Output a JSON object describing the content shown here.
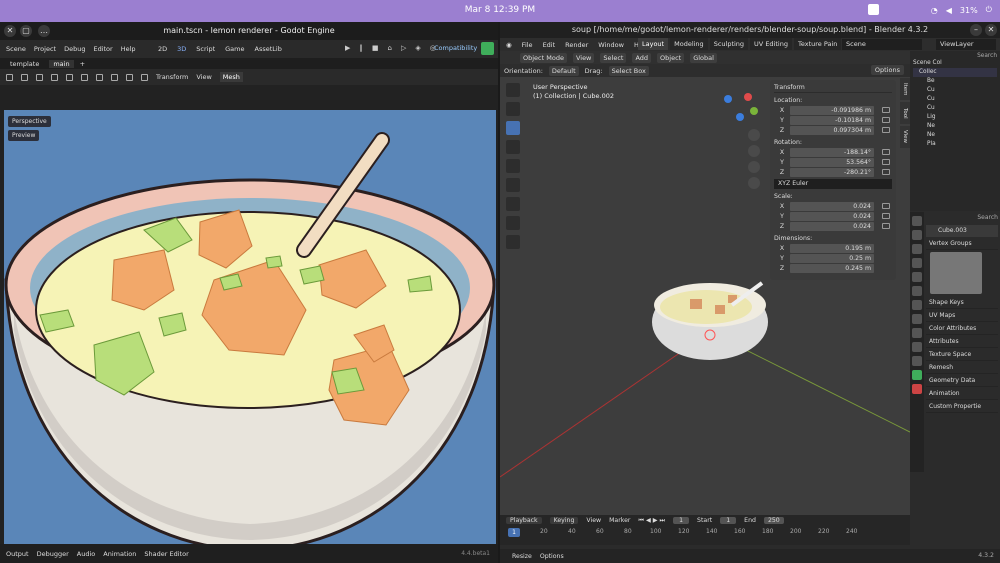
{
  "topbar": {
    "clock": "Mar 8  12:39 PM",
    "battery": "31%"
  },
  "godot": {
    "title": "main.tscn - lemon renderer - Godot Engine",
    "menu": [
      "Scene",
      "Project",
      "Debug",
      "Editor",
      "Help"
    ],
    "workspaces": [
      "2D",
      "3D",
      "Script",
      "Game",
      "AssetLib"
    ],
    "renderer": "Compatibility",
    "tabs": [
      "template",
      "main"
    ],
    "toolbar": {
      "transform": "Transform",
      "view": "View",
      "mesh": "Mesh"
    },
    "viewport": {
      "perspective": "Perspective",
      "preview": "Preview"
    },
    "bottom": [
      "Output",
      "Debugger",
      "Audio",
      "Animation",
      "Shader Editor"
    ],
    "version": "4.4.beta1"
  },
  "blender": {
    "title": "soup [/home/me/godot/lemon-renderer/renders/blender-soup/soup.blend] - Blender 4.3.2",
    "menu": [
      "File",
      "Edit",
      "Render",
      "Window",
      "Help"
    ],
    "workspaces": [
      "Layout",
      "Modeling",
      "Sculpting",
      "UV Editing",
      "Texture Pain"
    ],
    "scene": "Scene",
    "view_layer": "ViewLayer",
    "header": {
      "mode": "Object Mode",
      "view": "View",
      "select": "Select",
      "add": "Add",
      "object": "Object",
      "transform": "Global"
    },
    "header2": {
      "orientation_label": "Orientation:",
      "orientation": "Default",
      "drag_label": "Drag:",
      "drag": "Select Box",
      "options": "Options"
    },
    "viewport": {
      "line1": "User Perspective",
      "line2": "(1) Collection | Cube.002"
    },
    "npanel": {
      "title": "Transform",
      "location_label": "Location:",
      "location": [
        {
          "k": "X",
          "v": "-0.091986 m"
        },
        {
          "k": "Y",
          "v": "-0.10184 m"
        },
        {
          "k": "Z",
          "v": "0.097304 m"
        }
      ],
      "rotation_label": "Rotation:",
      "rotation": [
        {
          "k": "X",
          "v": "-188.14°"
        },
        {
          "k": "Y",
          "v": "53.564°"
        },
        {
          "k": "Z",
          "v": "-280.21°"
        }
      ],
      "euler": "XYZ Euler",
      "scale_label": "Scale:",
      "scale": [
        {
          "k": "X",
          "v": "0.024"
        },
        {
          "k": "Y",
          "v": "0.024"
        },
        {
          "k": "Z",
          "v": "0.024"
        }
      ],
      "dimensions_label": "Dimensions:",
      "dimensions": [
        {
          "k": "X",
          "v": "0.195 m"
        },
        {
          "k": "Y",
          "v": "0.25 m"
        },
        {
          "k": "Z",
          "v": "0.245 m"
        }
      ]
    },
    "ntabs": [
      "Item",
      "Tool",
      "View"
    ],
    "outliner": [
      "Scene Col",
      "Collec",
      "Be",
      "Cu",
      "Cu",
      "Cu",
      "Lig",
      "Ne",
      "Ne",
      "Pla"
    ],
    "search": "Search",
    "properties": {
      "object": "Cube.003",
      "sections": [
        "Vertex Groups",
        "Shape Keys",
        "UV Maps",
        "Color Attributes",
        "Attributes",
        "Texture Space",
        "Remesh",
        "Geometry Data",
        "Animation",
        "Custom Propertie"
      ]
    },
    "timeline": {
      "playback": "Playback",
      "keying": "Keying",
      "view": "View",
      "marker": "Marker",
      "current": "1",
      "start_label": "Start",
      "start": "1",
      "end_label": "End",
      "end": "250",
      "ticks": [
        "1",
        "20",
        "40",
        "60",
        "80",
        "100",
        "120",
        "140",
        "160",
        "180",
        "200",
        "220",
        "240"
      ]
    },
    "status": {
      "resize": "Resize",
      "options": "Options",
      "version": "4.3.2"
    }
  }
}
